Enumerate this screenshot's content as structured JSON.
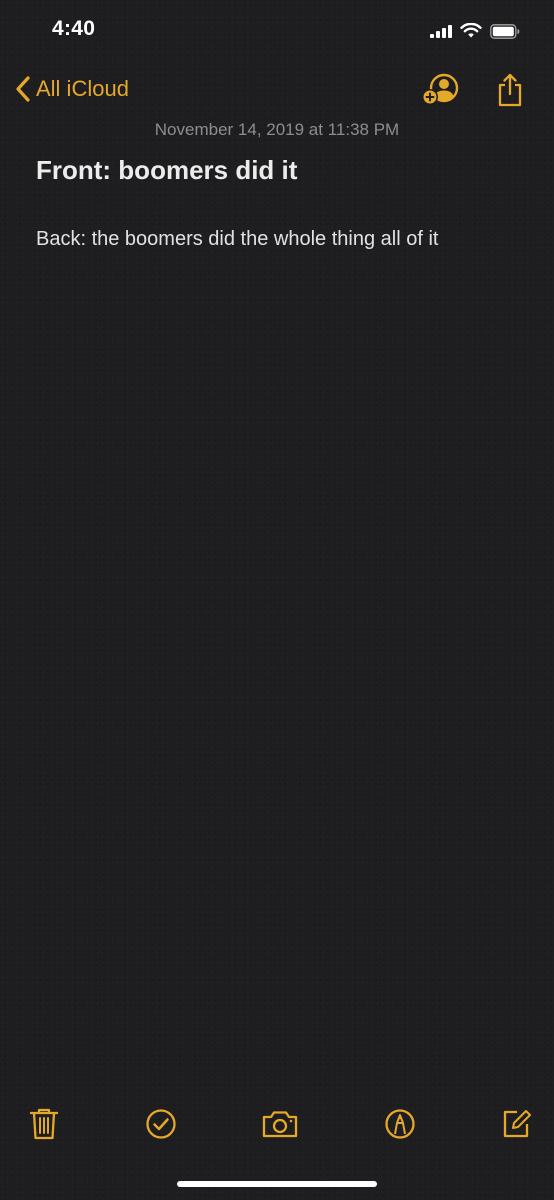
{
  "status_bar": {
    "time": "4:40"
  },
  "nav": {
    "back_label": "All iCloud"
  },
  "note": {
    "date": "November 14, 2019 at 11:38 PM",
    "title": "Front: boomers did it",
    "body": "Back: the boomers did the whole thing all of it"
  },
  "colors": {
    "accent": "#e5a829",
    "background": "#1e1e20",
    "date_text": "#8d8d92"
  },
  "icons": {
    "back": "chevron-left-icon",
    "add_people": "add-person-icon",
    "share": "share-icon",
    "trash": "trash-icon",
    "checklist": "checkmark-circle-icon",
    "camera": "camera-icon",
    "markup": "pen-circle-icon",
    "compose": "compose-icon"
  }
}
